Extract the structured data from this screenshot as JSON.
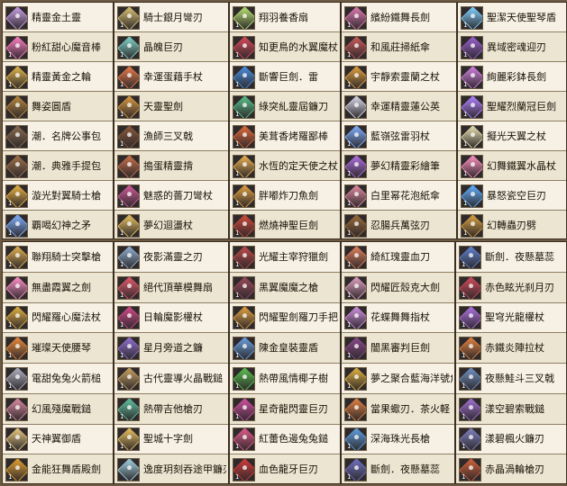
{
  "panels": [
    {
      "items": [
        {
          "name": "精靈金土靈",
          "icon": "staff-icon",
          "color": "#c9a0e6",
          "count": ""
        },
        {
          "name": "粉紅甜心魔音棒",
          "icon": "staff-icon",
          "color": "#ff7ec4",
          "count": "1"
        },
        {
          "name": "精靈黃金之輪",
          "icon": "staff-icon",
          "color": "#e0b54a",
          "count": "1"
        },
        {
          "name": "舞姿圓盾",
          "icon": "staff-icon",
          "color": "#b8873d",
          "count": ""
        },
        {
          "name": "潮．名牌公事包",
          "icon": "bag-icon",
          "color": "#8a6a4e",
          "count": ""
        },
        {
          "name": "潮．典雅手提包",
          "icon": "bag-icon",
          "color": "#a0714a",
          "count": ""
        },
        {
          "name": "漩光對翼騎士槍",
          "icon": "staff-icon",
          "color": "#e8b040",
          "count": "1"
        },
        {
          "name": "覇喝幻神之矛",
          "icon": "spear-icon",
          "color": "#7fb0ff",
          "count": "1"
        }
      ]
    },
    {
      "items": [
        {
          "name": "騎士銀月彎刃",
          "icon": "staff-icon",
          "color": "#d8c070",
          "count": "1"
        },
        {
          "name": "晶魄巨刃",
          "icon": "staff-icon",
          "color": "#7fd4c8",
          "count": "1"
        },
        {
          "name": "幸運蛋藉手杖",
          "icon": "staff-icon",
          "color": "#e87a4a",
          "count": "1"
        },
        {
          "name": "天靈聖劍",
          "icon": "staff-icon",
          "color": "#d89a40",
          "count": "1"
        },
        {
          "name": "漁師三叉戟",
          "icon": "staff-icon",
          "color": "#8a5a3a",
          "count": "1"
        },
        {
          "name": "搗蛋精靈揹",
          "icon": "staff-icon",
          "color": "#c8704a",
          "count": ""
        },
        {
          "name": "魅惑的薔刀彎杖",
          "icon": "staff-icon",
          "color": "#d05a9a",
          "count": "1"
        },
        {
          "name": "夢幻迴盪杖",
          "icon": "staff-icon",
          "color": "#e8c060",
          "count": "1"
        }
      ]
    },
    {
      "items": [
        {
          "name": "翔羽養香扇",
          "icon": "staff-icon",
          "color": "#b8e070",
          "count": "1"
        },
        {
          "name": "知更鳥的水翼魔杖",
          "icon": "staff-icon",
          "color": "#d84a5a",
          "count": "1"
        },
        {
          "name": "斷響巨劍．雷",
          "icon": "staff-icon",
          "color": "#4a90e0",
          "count": "1"
        },
        {
          "name": "綠突糺靈屆鐮刀",
          "icon": "staff-icon",
          "color": "#5ac08a",
          "count": "1"
        },
        {
          "name": "美茸香烤羅鄙棒",
          "icon": "staff-icon",
          "color": "#e06a3a",
          "count": "1"
        },
        {
          "name": "水恆的定天使之杖",
          "icon": "staff-icon",
          "color": "#e8b050",
          "count": "1"
        },
        {
          "name": "胖嘟炸刀魚劍",
          "icon": "staff-icon",
          "color": "#e0a040",
          "count": "1"
        },
        {
          "name": "燃燒神聖巨劍",
          "icon": "staff-icon",
          "color": "#d04a3a",
          "count": "1"
        }
      ]
    },
    {
      "items": [
        {
          "name": "繽紛鐵舞長劍",
          "icon": "staff-icon",
          "color": "#e07ab0",
          "count": "1"
        },
        {
          "name": "和風莊掃紙傘",
          "icon": "staff-icon",
          "color": "#c85a5a",
          "count": "1"
        },
        {
          "name": "宇靜索靈蘭之杖",
          "icon": "staff-icon",
          "color": "#e0a040",
          "count": "1"
        },
        {
          "name": "幸運精靈蓮公英",
          "icon": "staff-icon",
          "color": "#d8d8e8",
          "count": ""
        },
        {
          "name": "藍嶺弦雷羽杖",
          "icon": "staff-icon",
          "color": "#7fb0ff",
          "count": "1"
        },
        {
          "name": "夢幻精靈彩繪筆",
          "icon": "staff-icon",
          "color": "#b070e0",
          "count": "1"
        },
        {
          "name": "白里幂花泡紙傘",
          "icon": "staff-icon",
          "color": "#e08aa0",
          "count": "1"
        },
        {
          "name": "忍腸兵萬弦刃",
          "icon": "staff-icon",
          "color": "#9a6a3a",
          "count": "1"
        }
      ]
    },
    {
      "items": [
        {
          "name": "聖潔天使聖琴盾",
          "icon": "staff-icon",
          "color": "#7fd0ff",
          "count": "1"
        },
        {
          "name": "異域密魂迎刃",
          "icon": "staff-icon",
          "color": "#9a60d0",
          "count": "1"
        },
        {
          "name": "絢麗彩鉢長劍",
          "icon": "staff-icon",
          "color": "#d080e0",
          "count": "1"
        },
        {
          "name": "聖耀烈蘭冠巨劍",
          "icon": "staff-icon",
          "color": "#b080ff",
          "count": "1"
        },
        {
          "name": "擬光天翼之杖",
          "icon": "staff-icon",
          "color": "#e8e0b0",
          "count": "1"
        },
        {
          "name": "幻舞鐵翼水晶杖",
          "icon": "staff-icon",
          "color": "#ff90c0",
          "count": "1"
        },
        {
          "name": "暴怒瓷空巨刃",
          "icon": "staff-icon",
          "color": "#60b0ff",
          "count": "1"
        },
        {
          "name": "幻轉蟲刃劈",
          "icon": "staff-icon",
          "color": "#d8a040",
          "count": "1"
        }
      ]
    },
    {
      "items": [
        {
          "name": "聯翔騎士突擊槍",
          "icon": "spear-icon",
          "color": "#e0b050",
          "count": "1"
        },
        {
          "name": "無盡霞翼之劍",
          "icon": "staff-icon",
          "color": "#ff90c8",
          "count": ""
        },
        {
          "name": "閃耀羅心魔法杖",
          "icon": "staff-icon",
          "color": "#e0b040",
          "count": "1"
        },
        {
          "name": "璀璨天使腰琴",
          "icon": "staff-icon",
          "color": "#e88a3a",
          "count": "1"
        },
        {
          "name": "電甜兔兔火箭槌",
          "icon": "staff-icon",
          "color": "#b0b0c0",
          "count": "1"
        },
        {
          "name": "幻風殘魔戰鎚",
          "icon": "staff-icon",
          "color": "#d88aa0",
          "count": "1"
        },
        {
          "name": "天神翼御盾",
          "icon": "staff-icon",
          "color": "#e8c880",
          "count": "1"
        },
        {
          "name": "金能狂舞盾殿劍",
          "icon": "staff-icon",
          "color": "#e0a030",
          "count": "1"
        }
      ]
    },
    {
      "items": [
        {
          "name": "夜影滿靈之刃",
          "icon": "staff-icon",
          "color": "#90b0d0",
          "count": "1"
        },
        {
          "name": "絕代頂華模舞扇",
          "icon": "staff-icon",
          "color": "#e05a6a",
          "count": "1"
        },
        {
          "name": "日輪魔影權杖",
          "icon": "staff-icon",
          "color": "#d04a8a",
          "count": "1"
        },
        {
          "name": "星月旁道之鐮",
          "icon": "staff-icon",
          "color": "#9070d0",
          "count": "1"
        },
        {
          "name": "古代靈導火晶戰鎚",
          "icon": "staff-icon",
          "color": "#c8a060",
          "count": "1"
        },
        {
          "name": "熱帶吉他槍刃",
          "icon": "staff-icon",
          "color": "#60c0a0",
          "count": "1"
        },
        {
          "name": "聖城十字劍",
          "icon": "staff-icon",
          "color": "#e8c060",
          "count": "1"
        },
        {
          "name": "逸度玥刻吞途甲鐮刃",
          "icon": "staff-icon",
          "color": "#a0d0e0",
          "count": ""
        }
      ]
    },
    {
      "items": [
        {
          "name": "光耀主宰狩獵劍",
          "icon": "staff-icon",
          "color": "#c04a4a",
          "count": "1"
        },
        {
          "name": "黑翼魔魔之槍",
          "icon": "spear-icon",
          "color": "#9a4a5a",
          "count": "1"
        },
        {
          "name": "閃耀聖劍羅刀手把",
          "icon": "staff-icon",
          "color": "#e0a040",
          "count": "1"
        },
        {
          "name": "陳金皇裝靈盾",
          "icon": "staff-icon",
          "color": "#6aa0e0",
          "count": "1"
        },
        {
          "name": "熱帶風情椰子樹",
          "icon": "staff-icon",
          "color": "#5ac050",
          "count": "1"
        },
        {
          "name": "星奇龍閃靈巨刃",
          "icon": "staff-icon",
          "color": "#d050a0",
          "count": "1"
        },
        {
          "name": "紅蕾色邊兔兔鎚",
          "icon": "staff-icon",
          "color": "#e05a8a",
          "count": "1"
        },
        {
          "name": "血色龍牙巨刃",
          "icon": "staff-icon",
          "color": "#d03a3a",
          "count": "1"
        }
      ]
    },
    {
      "items": [
        {
          "name": "綺紅瑰靈血刀",
          "icon": "staff-icon",
          "color": "#e0805a",
          "count": "1"
        },
        {
          "name": "閃耀匠殼克大劍",
          "icon": "staff-icon",
          "color": "#e0a0c0",
          "count": "1"
        },
        {
          "name": "花蝶舞舞指杖",
          "icon": "staff-icon",
          "color": "#d090e0",
          "count": "1"
        },
        {
          "name": "闇黑審判巨劍",
          "icon": "staff-icon",
          "color": "#8a4a8a",
          "count": "1"
        },
        {
          "name": "夢之聚合藍海洋號角",
          "icon": "staff-icon",
          "color": "#e0b040",
          "count": "1"
        },
        {
          "name": "當果蠍刃．茶火軽",
          "icon": "staff-icon",
          "color": "#e08040",
          "count": "1"
        },
        {
          "name": "深海珠光長槍",
          "icon": "spear-icon",
          "color": "#60a0e0",
          "count": "1"
        },
        {
          "name": "斷劍．夜懸墓蕊",
          "icon": "staff-icon",
          "color": "#7070c0",
          "count": "1"
        }
      ]
    },
    {
      "items": [
        {
          "name": "斷劍．夜懸墓蕊",
          "icon": "staff-icon",
          "color": "#6080d0",
          "count": "1"
        },
        {
          "name": "赤色眩光刹月刃",
          "icon": "staff-icon",
          "color": "#d04a5a",
          "count": "1"
        },
        {
          "name": "聖穹光龍權杖",
          "icon": "staff-icon",
          "color": "#b070e0",
          "count": "1"
        },
        {
          "name": "赤鐵炎陣拉杖",
          "icon": "staff-icon",
          "color": "#e08040",
          "count": "1"
        },
        {
          "name": "夜懸鮭斗三叉戟",
          "icon": "staff-icon",
          "color": "#7090c0",
          "count": "1"
        },
        {
          "name": "漾空碧索戰鎚",
          "icon": "staff-icon",
          "color": "#a070d0",
          "count": "1"
        },
        {
          "name": "漾碧楓火鐮刃",
          "icon": "staff-icon",
          "color": "#8080c0",
          "count": "1"
        },
        {
          "name": "赤晶渦輪槍刃",
          "icon": "staff-icon",
          "color": "#d0603a",
          "count": "1"
        }
      ]
    }
  ]
}
